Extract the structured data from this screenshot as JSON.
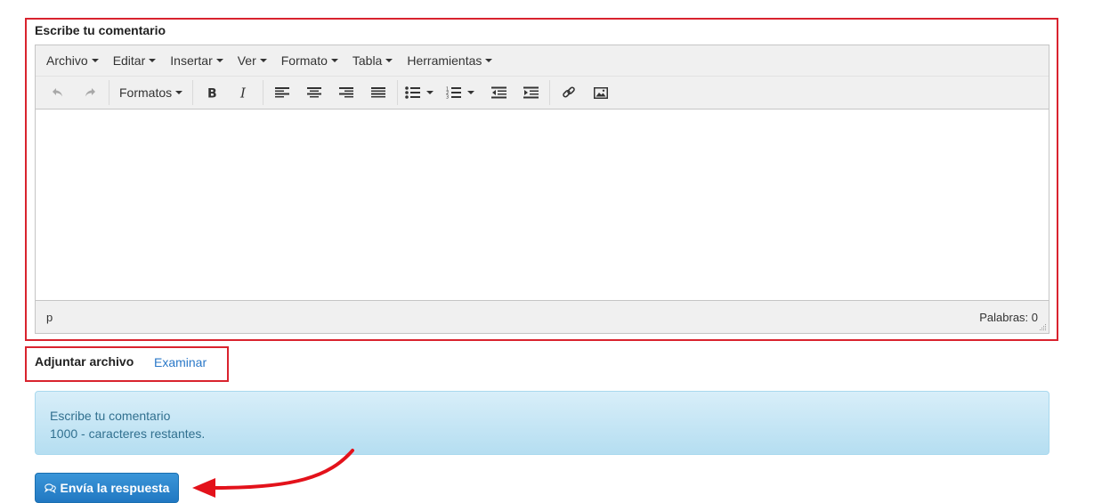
{
  "editor": {
    "title": "Escribe tu comentario",
    "menu": [
      "Archivo",
      "Editar",
      "Insertar",
      "Ver",
      "Formato",
      "Tabla",
      "Herramientas"
    ],
    "toolbar": {
      "formats_label": "Formatos",
      "icons": [
        "undo-icon",
        "redo-icon",
        "bold-icon",
        "italic-icon",
        "align-left-icon",
        "align-center-icon",
        "align-right-icon",
        "align-justify-icon",
        "bullet-list-icon",
        "numbered-list-icon",
        "outdent-icon",
        "indent-icon",
        "link-icon",
        "image-icon"
      ]
    },
    "content": "",
    "status": {
      "path": "p",
      "word_count": "Palabras: 0"
    }
  },
  "attachment": {
    "label": "Adjuntar archivo",
    "browse_label": "Examinar"
  },
  "info": {
    "line1": "Escribe tu comentario",
    "line2": "1000 - caracteres restantes."
  },
  "submit": {
    "label": "Envía la respuesta",
    "icon": "comments-icon"
  },
  "colors": {
    "highlight": "#d9232e",
    "link": "#2a78c8",
    "button": "#2178c2",
    "info_bg": "#c9e8f6",
    "info_text": "#31708f"
  }
}
